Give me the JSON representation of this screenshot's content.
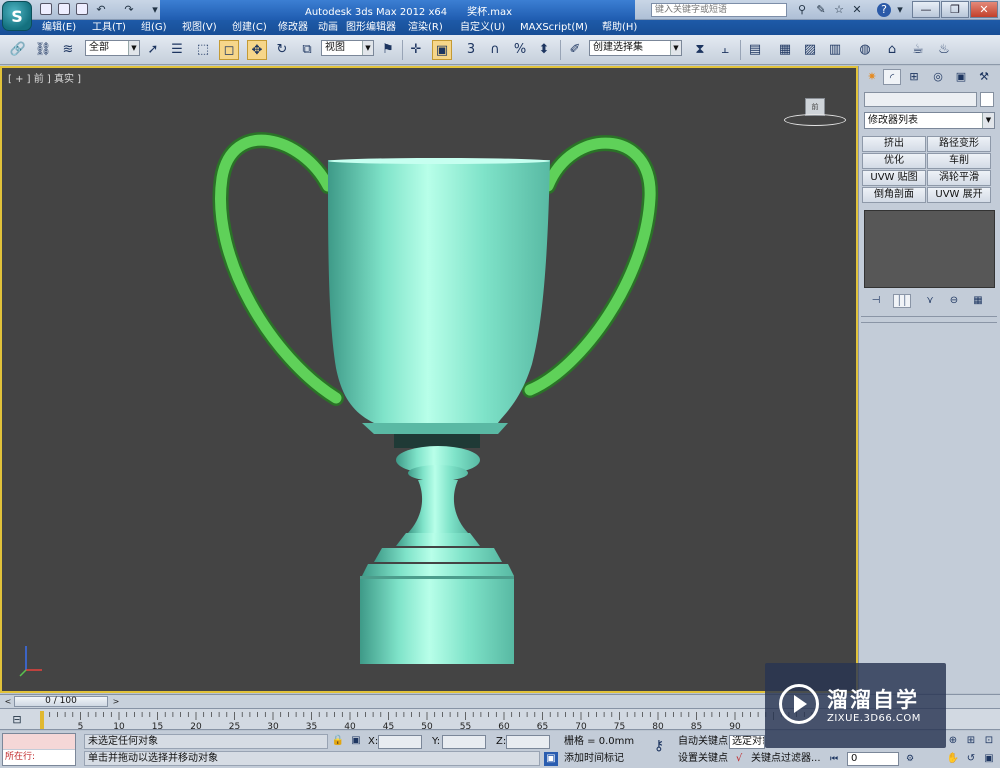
{
  "titlebar": {
    "app_title": "Autodesk 3ds Max  2012 x64",
    "file_name": "奖杯.max",
    "search_placeholder": "键入关键字或短语",
    "minimize": "—",
    "maximize": "❐",
    "close": "✕"
  },
  "menubar": {
    "items": [
      "编辑(E)",
      "工具(T)",
      "组(G)",
      "视图(V)",
      "创建(C)",
      "修改器",
      "动画",
      "图形编辑器",
      "渲染(R)",
      "自定义(U)",
      "MAXScript(M)",
      "帮助(H)"
    ]
  },
  "toolbar": {
    "selection_filter": "全部",
    "reference_coord": "视图",
    "named_selection": "创建选择集",
    "snap_angle": "3",
    "snap_percent": "%"
  },
  "viewport": {
    "label": "[ + ] 前 ] 真实 ]",
    "viewcube_label": "前",
    "trophy_colors": {
      "cup": "#7fe3c9",
      "handles": "#4fc44b",
      "background": "#444444"
    }
  },
  "command_panel": {
    "modifier_list": "修改器列表",
    "modifier_buttons": [
      "挤出",
      "路径变形",
      "优化",
      "车削",
      "UVW 贴图",
      "涡轮平滑",
      "倒角剖面",
      "UVW 展开"
    ]
  },
  "timeline": {
    "frame_display": "0 / 100",
    "ticks": [
      "5",
      "10",
      "15",
      "20",
      "25",
      "30",
      "35",
      "40",
      "45",
      "50",
      "55",
      "60",
      "65",
      "70",
      "75",
      "80",
      "85",
      "90"
    ]
  },
  "statusbar": {
    "script_status": "所在行:",
    "selection_status": "未选定任何对象",
    "prompt": "单击并拖动以选择并移动对象",
    "x_label": "X:",
    "y_label": "Y:",
    "z_label": "Z:",
    "grid": "栅格 = 0.0mm",
    "add_time_tag": "添加时间标记",
    "auto_key": "自动关键点",
    "set_key": "设置关键点",
    "selected_label": "选定对象",
    "key_filters": "关键点过滤器...",
    "frame_value": "0"
  },
  "watermark": {
    "title": "溜溜自学",
    "url": "ZIXUE.3D66.COM"
  }
}
